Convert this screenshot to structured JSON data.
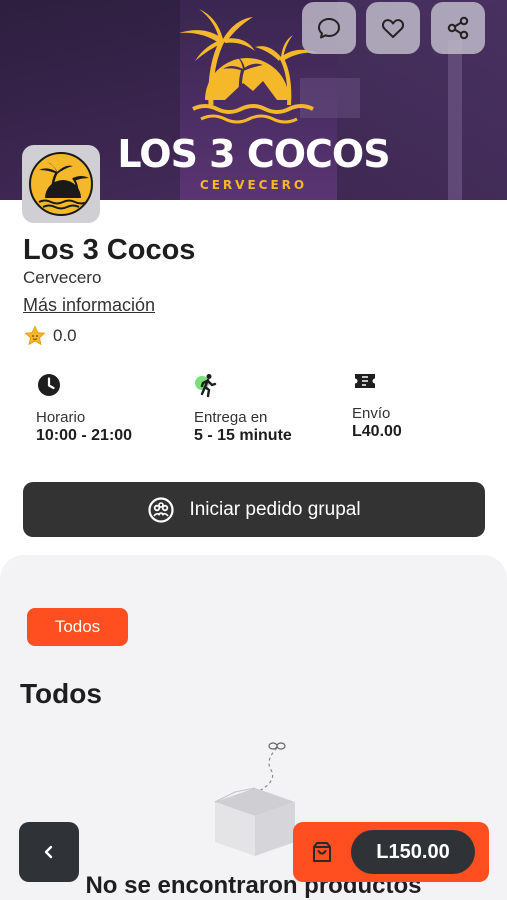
{
  "hero": {
    "logo_title": "LOS 3 COCOS",
    "logo_subtitle": "CERVECERO"
  },
  "top_actions": [
    {
      "name": "chat-icon"
    },
    {
      "name": "heart-icon"
    },
    {
      "name": "share-icon"
    }
  ],
  "store": {
    "name": "Los 3 Cocos",
    "category": "Cervecero",
    "more_info": "Más información",
    "rating": "0.0"
  },
  "info": {
    "hours_label": "Horario",
    "hours_value": "10:00 - 21:00",
    "delivery_label": "Entrega en",
    "delivery_value": "5 - 15 minute",
    "shipping_label": "Envío",
    "shipping_value": "L40.00"
  },
  "group_order_label": "Iniciar pedido grupal",
  "menu": {
    "chips": [
      "Todos"
    ],
    "section_title": "Todos",
    "empty_text": "No se encontraron productos"
  },
  "cart": {
    "total": "L150.00"
  },
  "colors": {
    "accent": "#ff4e1f",
    "dark": "#2f3338",
    "brand_yellow": "#f5b82a",
    "hero_purple": "#4b2d63"
  }
}
